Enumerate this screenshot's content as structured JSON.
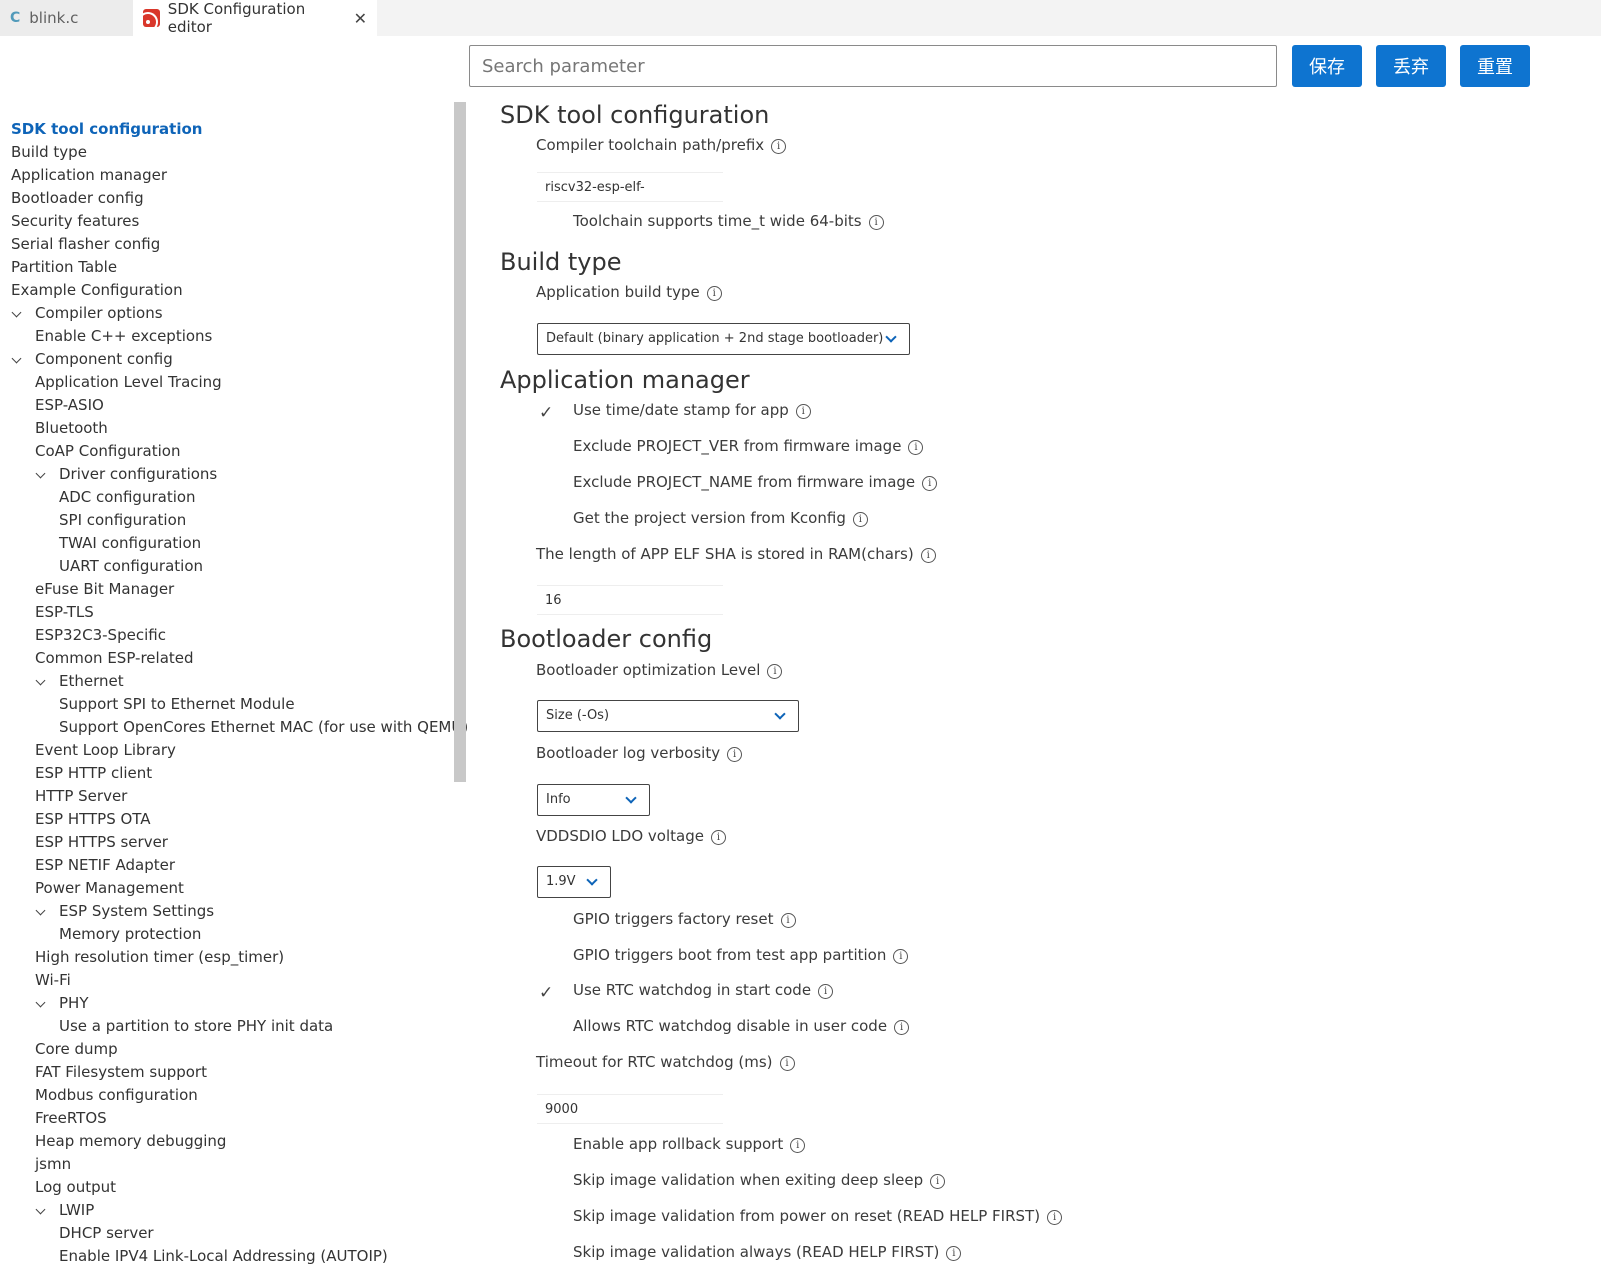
{
  "tabs": [
    {
      "label": "blink.c",
      "icon": "c-file-icon"
    },
    {
      "label": "SDK Configuration editor",
      "icon": "rss-icon"
    }
  ],
  "toolbar": {
    "search_placeholder": "Search parameter",
    "save": "保存",
    "discard": "丢弃",
    "reset": "重置"
  },
  "sidebar": [
    "SDK tool configuration",
    "Build type",
    "Application manager",
    "Bootloader config",
    "Security features",
    "Serial flasher config",
    "Partition Table",
    "Example Configuration",
    "Compiler options",
    "Enable C++ exceptions",
    "Component config",
    "Application Level Tracing",
    "ESP-ASIO",
    "Bluetooth",
    "CoAP Configuration",
    "Driver configurations",
    "ADC configuration",
    "SPI configuration",
    "TWAI configuration",
    "UART configuration",
    "eFuse Bit Manager",
    "ESP-TLS",
    "ESP32C3-Specific",
    "Common ESP-related",
    "Ethernet",
    "Support SPI to Ethernet Module",
    "Support OpenCores Ethernet MAC (for use with QEMU)",
    "Event Loop Library",
    "ESP HTTP client",
    "HTTP Server",
    "ESP HTTPS OTA",
    "ESP HTTPS server",
    "ESP NETIF Adapter",
    "Power Management",
    "ESP System Settings",
    "Memory protection",
    "High resolution timer (esp_timer)",
    "Wi-Fi",
    "PHY",
    "Use a partition to store PHY init data",
    "Core dump",
    "FAT Filesystem support",
    "Modbus configuration",
    "FreeRTOS",
    "Heap memory debugging",
    "jsmn",
    "Log output",
    "LWIP",
    "DHCP server",
    "Enable IPV4 Link-Local Addressing (AUTOIP)"
  ],
  "content": {
    "sdk_tool": {
      "heading": "SDK tool configuration",
      "toolchain_label": "Compiler toolchain path/prefix",
      "toolchain_value": "riscv32-esp-elf-",
      "time_t_label": "Toolchain supports time_t wide 64-bits"
    },
    "build_type": {
      "heading": "Build type",
      "app_build_label": "Application build type",
      "app_build_value": "Default (binary application + 2nd stage bootloader)"
    },
    "app_manager": {
      "heading": "Application manager",
      "timestamp_label": "Use time/date stamp for app",
      "timestamp_checked": true,
      "exclude_ver_label": "Exclude PROJECT_VER from firmware image",
      "exclude_name_label": "Exclude PROJECT_NAME from firmware image",
      "kconfig_label": "Get the project version from Kconfig",
      "sha_label": "The length of APP ELF SHA is stored in RAM(chars)",
      "sha_value": "16"
    },
    "bootloader": {
      "heading": "Bootloader config",
      "opt_label": "Bootloader optimization Level",
      "opt_value": "Size (-Os)",
      "log_label": "Bootloader log verbosity",
      "log_value": "Info",
      "vdd_label": "VDDSDIO LDO voltage",
      "vdd_value": "1.9V",
      "gpio_reset_label": "GPIO triggers factory reset",
      "gpio_test_label": "GPIO triggers boot from test app partition",
      "rtc_wdt_label": "Use RTC watchdog in start code",
      "rtc_wdt_checked": true,
      "rtc_disable_label": "Allows RTC watchdog disable in user code",
      "rtc_timeout_label": "Timeout for RTC watchdog (ms)",
      "rtc_timeout_value": "9000",
      "rollback_label": "Enable app rollback support",
      "skip_deep_label": "Skip image validation when exiting deep sleep",
      "skip_power_label": "Skip image validation from power on reset (READ HELP FIRST)",
      "skip_always_label": "Skip image validation always (READ HELP FIRST)"
    }
  },
  "check_glyph": "✓",
  "info_glyph": "i"
}
